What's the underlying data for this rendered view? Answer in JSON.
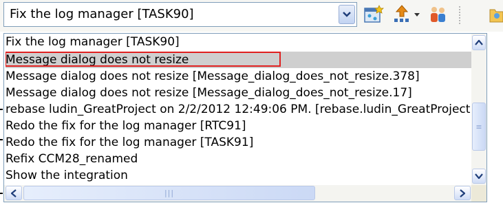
{
  "combo": {
    "value": "Fix the log manager [TASK90]",
    "dropdown_icon": "chevron-down-icon"
  },
  "toolbar": {
    "icons": [
      "new-query-icon",
      "upload-icon",
      "dropdown-arrow-icon",
      "team-icon",
      "folder-icon"
    ]
  },
  "list": {
    "items": [
      {
        "label": "Fix the log manager [TASK90]"
      },
      {
        "label": "Message dialog does not resize",
        "selected": true
      },
      {
        "label": "Message dialog does not resize [Message_dialog_does_not_resize.378]"
      },
      {
        "label": "Message dialog does not resize [Message_dialog_does_not_resize.17]"
      },
      {
        "label": "rebase ludin_GreatProject on 2/2/2012 12:49:06 PM. [rebase.ludin_GreatProject"
      },
      {
        "label": "Redo the fix for the log manager [RTC91]"
      },
      {
        "label": "Redo the fix for the log manager [TASK91]"
      },
      {
        "label": "Refix CCM28_renamed"
      },
      {
        "label": "Show the integration"
      }
    ]
  },
  "scroll": {
    "up_icon": "arrow-up-icon",
    "down_icon": "arrow-down-icon",
    "left_icon": "arrow-left-icon",
    "right_icon": "arrow-right-icon"
  },
  "colors": {
    "selection_highlight": "#cfcfcf",
    "selection_outline": "#e02020",
    "border": "#7f9db9"
  }
}
